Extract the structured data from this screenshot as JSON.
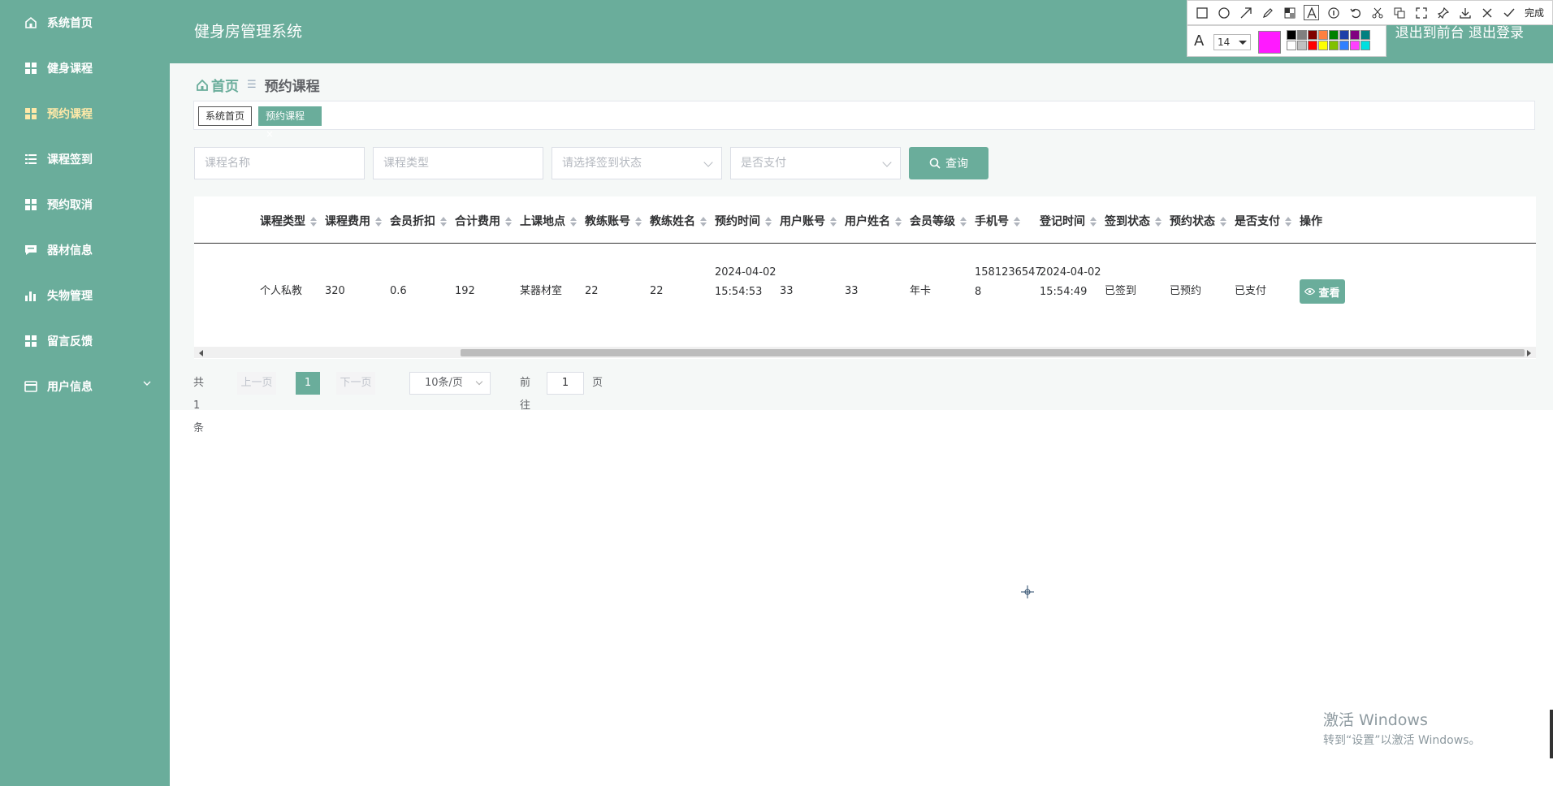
{
  "app": {
    "title": "健身房管理系统",
    "logout_label": "退出到前台 退出登录"
  },
  "sidebar": {
    "items": [
      {
        "label": "系统首页",
        "icon": "home-icon"
      },
      {
        "label": "健身课程",
        "icon": "grid-icon"
      },
      {
        "label": "预约课程",
        "icon": "grid-icon",
        "active": true
      },
      {
        "label": "课程签到",
        "icon": "list-icon"
      },
      {
        "label": "预约取消",
        "icon": "grid-icon"
      },
      {
        "label": "器材信息",
        "icon": "chat-icon"
      },
      {
        "label": "失物管理",
        "icon": "bar-chart-icon"
      },
      {
        "label": "留言反馈",
        "icon": "grid-icon"
      },
      {
        "label": "用户信息",
        "icon": "card-icon"
      }
    ]
  },
  "breadcrumb": {
    "home": "首页",
    "current": "预约课程"
  },
  "tabs": [
    {
      "label": "系统首页"
    },
    {
      "label": "预约课程 ×"
    }
  ],
  "filters": {
    "course_name": "课程名称",
    "course_type": "课程类型",
    "checkin_status": "请选择签到状态",
    "paid": "是否支付",
    "query_label": "查询"
  },
  "table": {
    "columns": [
      "课程类型",
      "课程费用",
      "会员折扣",
      "合计费用",
      "上课地点",
      "教练账号",
      "教练姓名",
      "预约时间",
      "用户账号",
      "用户姓名",
      "会员等级",
      "手机号",
      "登记时间",
      "签到状态",
      "预约状态",
      "是否支付",
      "操作"
    ],
    "rows": [
      {
        "course_type": "个人私教",
        "fee": "320",
        "discount": "0.6",
        "total": "192",
        "location": "某器材室",
        "coach_account": "22",
        "coach_name": "22",
        "booking_time_date": "2024-04-02",
        "booking_time_clock": "15:54:53",
        "user_account": "33",
        "user_name": "33",
        "member_level": "年卡",
        "phone_part1": "1581236547",
        "phone_part2": "8",
        "register_time_date": "2024-04-02",
        "register_time_clock": "15:54:49",
        "checkin": "已签到",
        "booking_status": "已预约",
        "paid": "已支付",
        "view_label": "查看"
      }
    ]
  },
  "pagination": {
    "total": "共 1 条",
    "prev": "上一页",
    "page": "1",
    "next": "下一页",
    "page_size": "10条/页",
    "goto_label": "前往",
    "goto_value": "1",
    "page_suffix": "页"
  },
  "snip_toolbar": {
    "done_label": "完成",
    "font_size": "14",
    "current_color": "#ff1aff",
    "palette": [
      "#000000",
      "#808080",
      "#800000",
      "#ff8040",
      "#008000",
      "#1e3fa8",
      "#800080",
      "#008080",
      "#ffffff",
      "#c0c0c0",
      "#ff0000",
      "#ffff00",
      "#80c000",
      "#3080ff",
      "#ff40ff",
      "#00e0e0"
    ]
  },
  "watermark": {
    "line1": "激活 Windows",
    "line2": "转到“设置”以激活 Windows。"
  },
  "colors": {
    "brand": "#6aad9b",
    "active_menu": "#ffe9a8"
  }
}
